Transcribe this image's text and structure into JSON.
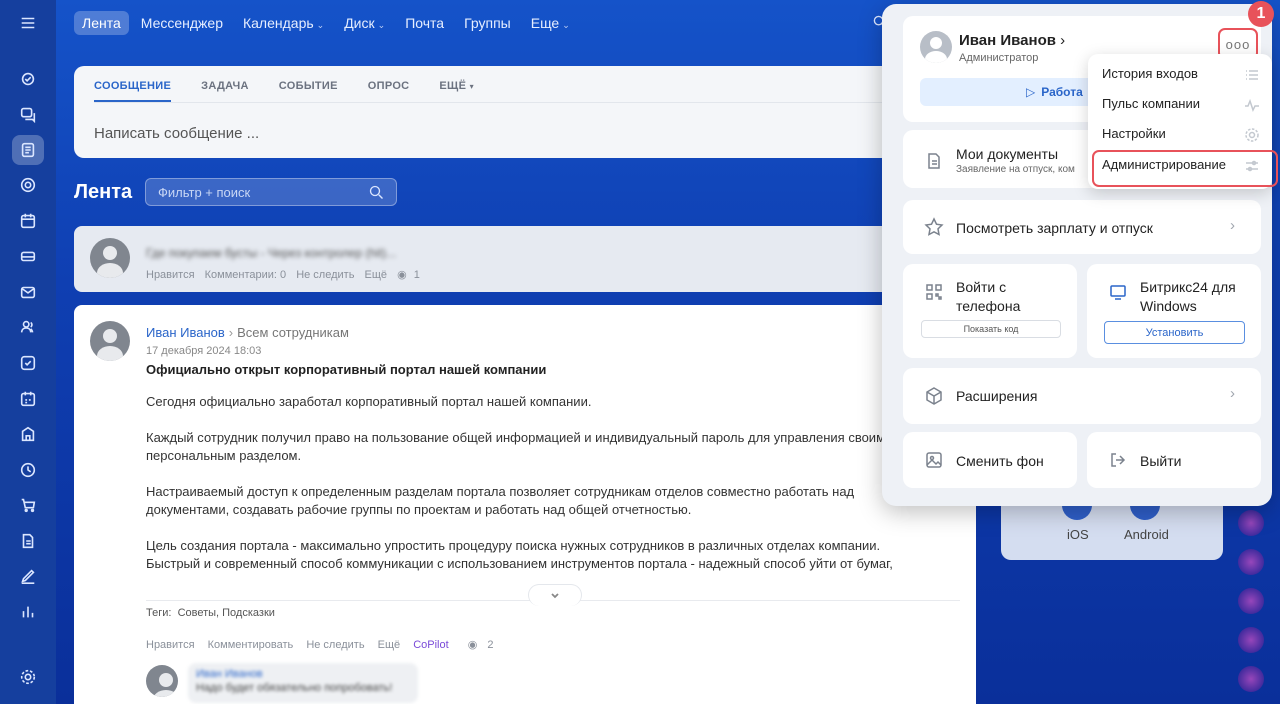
{
  "topnav": {
    "items": [
      {
        "label": "Лента",
        "active": true,
        "caret": false
      },
      {
        "label": "Мессенджер",
        "active": false,
        "caret": false
      },
      {
        "label": "Календарь",
        "active": false,
        "caret": true
      },
      {
        "label": "Диск",
        "active": false,
        "caret": true
      },
      {
        "label": "Почта",
        "active": false,
        "caret": false
      },
      {
        "label": "Группы",
        "active": false,
        "caret": false
      },
      {
        "label": "Еще",
        "active": false,
        "caret": true
      }
    ]
  },
  "composer": {
    "tabs": [
      "СООБЩЕНИЕ",
      "ЗАДАЧА",
      "СОБЫТИЕ",
      "ОПРОС",
      "ЕЩЁ"
    ],
    "placeholder": "Написать сообщение ..."
  },
  "feed": {
    "title": "Лента",
    "search_placeholder": "Фильтр + поиск"
  },
  "post_blurred": {
    "text": "Где покупаем бусты - Через контролер (hit)...",
    "actions": [
      "Нравится",
      "Комментарии: 0",
      "Не следить",
      "Ещё"
    ],
    "views": "1"
  },
  "post": {
    "author": "Иван Иванов",
    "audience": "Всем сотрудникам",
    "date": "17 декабря 2024 18:03",
    "title": "Официально открыт корпоративный портал нашей компании",
    "paragraphs": [
      "Сегодня официально заработал корпоративный портал нашей компании.",
      "Каждый сотрудник получил право на пользование общей информацией и индивидуальный пароль для управления своим персональным разделом.",
      "Настраиваемый доступ к определенным разделам портала позволяет сотрудникам отделов совместно работать над документами, создавать рабочие группы по проектам и работать над общей отчетностью.",
      "Цель создания портала - максимально упростить процедуру поиска нужных сотрудников в различных отделах компании. Быстрый и современный способ коммуникации с использованием инструментов портала - надежный способ уйти от бумаг, перевести информационный поток в электронный вид."
    ],
    "tags_label": "Теги:",
    "tags": "Советы, Подсказки",
    "actions": [
      "Нравится",
      "Комментировать",
      "Не следить",
      "Ещё"
    ],
    "copilot": "CoPilot",
    "views": "2",
    "comment_author": "Иван Иванов",
    "comment_text": "Надо будет обязательно попробовать!"
  },
  "app_card": {
    "ios": "iOS",
    "android": "Android"
  },
  "profile": {
    "name": "Иван Иванов",
    "role": "Администратор",
    "work_button": "Работа",
    "more": "ooo",
    "badge": "1",
    "my_docs": {
      "title": "Мои документы",
      "subtitle": "Заявление на отпуск, ком"
    },
    "salary": "Посмотреть зарплату и отпуск",
    "phone_login": {
      "title": "Войти с телефона",
      "button": "Показать код"
    },
    "windows": {
      "title": "Битрикс24 для Windows",
      "button": "Установить"
    },
    "extensions": "Расширения",
    "change_bg": "Сменить фон",
    "logout": "Выйти"
  },
  "dropdown": {
    "items": [
      "История входов",
      "Пульс компании",
      "Настройки",
      "Администрирование"
    ]
  },
  "colors": {
    "accent": "#2a65c9",
    "highlight": "#e8525a",
    "background": "#1553c9"
  }
}
